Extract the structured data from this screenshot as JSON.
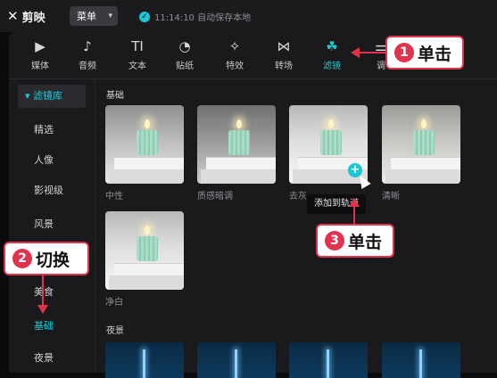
{
  "app": {
    "logo_text": "剪映",
    "menu_label": "菜单",
    "save_status": "11:14:10 自动保存本地"
  },
  "toolbar": {
    "items": [
      {
        "label": "媒体",
        "icon": "media-icon"
      },
      {
        "label": "音频",
        "icon": "audio-icon"
      },
      {
        "label": "文本",
        "icon": "text-icon"
      },
      {
        "label": "贴纸",
        "icon": "sticker-icon"
      },
      {
        "label": "特效",
        "icon": "effects-icon"
      },
      {
        "label": "转场",
        "icon": "transition-icon"
      },
      {
        "label": "滤镜",
        "icon": "filter-icon"
      },
      {
        "label": "调",
        "icon": "adjust-icon"
      }
    ],
    "active_index": 6
  },
  "sidebar": {
    "header": "滤镜库",
    "items": [
      "精选",
      "人像",
      "影视级",
      "风景",
      "美食",
      "基础",
      "夜景"
    ],
    "active_item": "基础"
  },
  "content": {
    "section_basic": "基础",
    "section_night": "夜景",
    "filters": [
      {
        "label": "中性"
      },
      {
        "label": "质感暗调"
      },
      {
        "label": "去灰"
      },
      {
        "label": "清晰"
      },
      {
        "label": "净白"
      }
    ],
    "tooltip": "添加到轨道"
  },
  "annotations": [
    {
      "number": "1",
      "text": "单击"
    },
    {
      "number": "2",
      "text": "切换"
    },
    {
      "number": "3",
      "text": "单击"
    }
  ],
  "colors": {
    "accent": "#1fcad8",
    "annotation": "#e0334d"
  }
}
